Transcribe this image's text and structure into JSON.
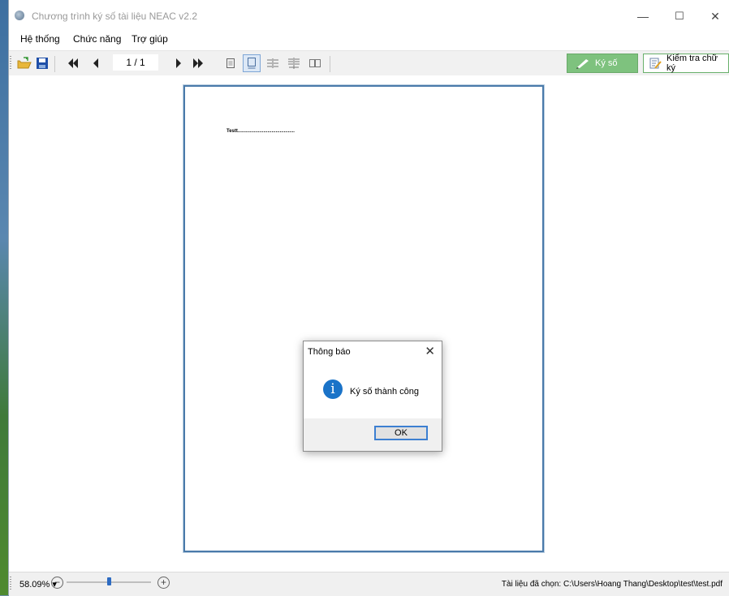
{
  "window": {
    "title": "Chương trình ký số tài liệu NEAC v2.2",
    "minimize": "—",
    "maximize": "☐",
    "close": "✕"
  },
  "menu": [
    "Hệ thống",
    "Chức năng",
    "Trợ giúp"
  ],
  "toolbar": {
    "page_indicator": "1 / 1",
    "sign_label": "Ký số",
    "verify_label": "Kiểm tra chữ ký",
    "icons": [
      "open-folder-icon",
      "save-icon",
      "first-page-icon",
      "prev-page-icon",
      "next-page-icon",
      "last-page-icon",
      "single-page-icon",
      "continuous-page-icon",
      "facing-icon",
      "facing-continuous-icon",
      "book-view-icon"
    ]
  },
  "document": {
    "text": "Testt.........................................."
  },
  "dialog": {
    "title": "Thông báo",
    "close": "✕",
    "icon": "i",
    "message": "Ký số thành công",
    "ok_label": "OK"
  },
  "statusbar": {
    "zoom": "58.09% ▾",
    "zoom_level_percent": 58.09,
    "slider_fraction": 0.5,
    "file_path": "Tài liệu đã chọn: C:\\Users\\Hoang Thang\\Desktop\\test\\test.pdf"
  },
  "colors": {
    "sign_button": "#7ec27e",
    "page_border": "#4a7aaa",
    "info_icon": "#1a73c8",
    "ok_focus": "#3c7fd1"
  }
}
